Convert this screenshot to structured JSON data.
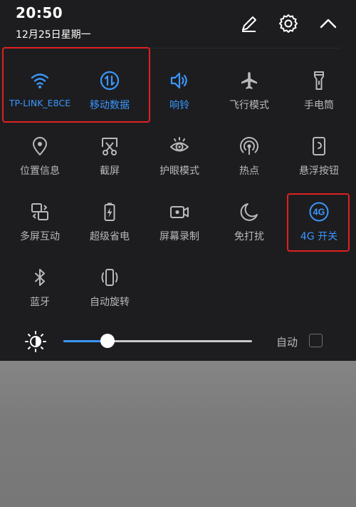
{
  "status": {
    "time": "20:50",
    "date": "12月25日星期一"
  },
  "header_icons": [
    "edit-icon",
    "settings-icon",
    "collapse-chevron-icon"
  ],
  "tiles": [
    {
      "label": "TP-LINK_E8CE",
      "icon": "wifi-icon",
      "active": true
    },
    {
      "label": "移动数据",
      "icon": "mobile-data-icon",
      "active": true
    },
    {
      "label": "响铃",
      "icon": "ring-icon",
      "active": true
    },
    {
      "label": "飞行模式",
      "icon": "airplane-icon",
      "active": false
    },
    {
      "label": "手电筒",
      "icon": "flashlight-icon",
      "active": false
    },
    {
      "label": "位置信息",
      "icon": "location-icon",
      "active": false
    },
    {
      "label": "截屏",
      "icon": "screenshot-icon",
      "active": false
    },
    {
      "label": "护眼模式",
      "icon": "eye-icon",
      "active": false
    },
    {
      "label": "热点",
      "icon": "hotspot-icon",
      "active": false
    },
    {
      "label": "悬浮按钮",
      "icon": "floating-button-icon",
      "active": false
    },
    {
      "label": "多屏互动",
      "icon": "multiscreen-icon",
      "active": false
    },
    {
      "label": "超级省电",
      "icon": "battery-saver-icon",
      "active": false
    },
    {
      "label": "屏幕录制",
      "icon": "screen-record-icon",
      "active": false
    },
    {
      "label": "免打扰",
      "icon": "moon-icon",
      "active": false
    },
    {
      "label": "4G 开关",
      "icon": "4g-icon",
      "active": true
    },
    {
      "label": "蓝牙",
      "icon": "bluetooth-icon",
      "active": false
    },
    {
      "label": "自动旋转",
      "icon": "auto-rotate-icon",
      "active": false
    }
  ],
  "brightness": {
    "icon": "brightness-icon",
    "level": 0.235,
    "auto_label": "自动",
    "auto_checked": false
  },
  "colors": {
    "accent": "#3a97ff",
    "highlight": "#e02020",
    "panel": "#1d1d1f",
    "text_inactive": "#b9b9bb"
  }
}
